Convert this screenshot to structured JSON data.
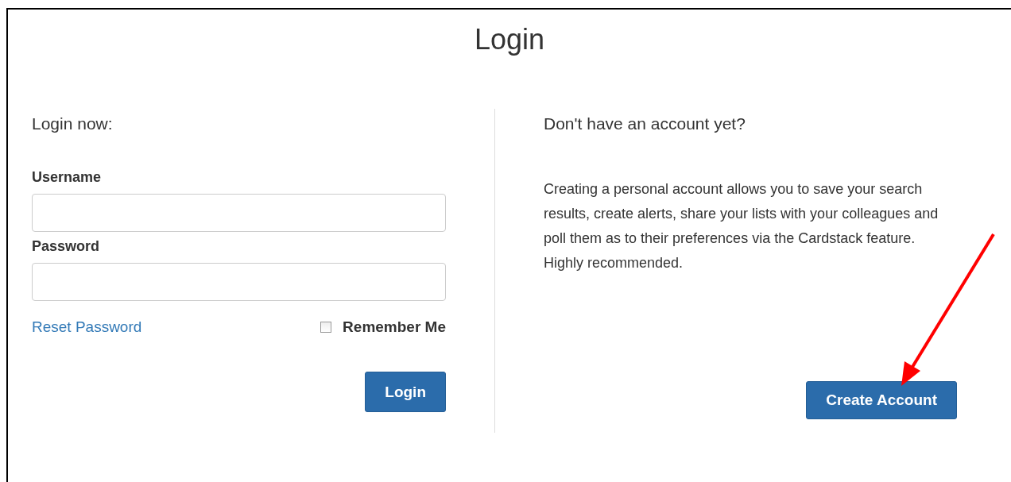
{
  "title": "Login",
  "login": {
    "heading": "Login now:",
    "username_label": "Username",
    "password_label": "Password",
    "reset_link": "Reset Password",
    "remember_me": {
      "label": "Remember Me",
      "checked": false
    },
    "button": "Login"
  },
  "signup": {
    "heading": "Don't have an account yet?",
    "text": "Creating a personal account allows you to save your search results, create alerts, share your lists with your colleagues and poll them as to their preferences via the Cardstack feature. Highly recommended.",
    "button": "Create Account"
  }
}
